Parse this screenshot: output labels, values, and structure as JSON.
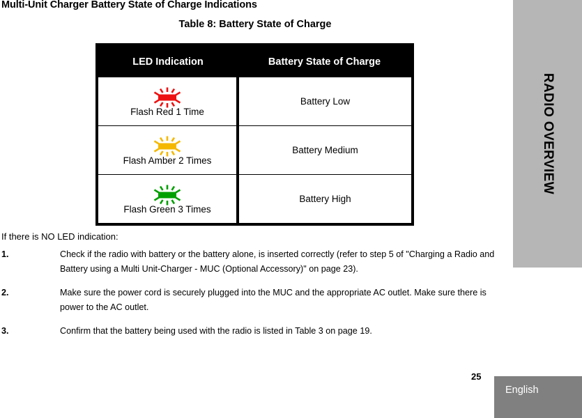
{
  "chapter_tab": {
    "label": "RADIO OVERVIEW",
    "background_color": "#b6b6b6"
  },
  "section_heading": "Multi-Unit Charger Battery State of Charge Indications",
  "table": {
    "caption": "Table 8: Battery State of Charge",
    "header_background": "#000000",
    "header_text_color": "#ffffff",
    "columns": [
      "LED Indication",
      "Battery State of Charge"
    ],
    "rows": [
      {
        "icon_name": "flash-red-led-icon",
        "icon_color": "#ee1111",
        "led_label": "Flash Red 1 Time",
        "state_of_charge": "Battery Low"
      },
      {
        "icon_name": "flash-amber-led-icon",
        "icon_color": "#f5b800",
        "led_label": "Flash Amber 2 Times",
        "state_of_charge": "Battery Medium"
      },
      {
        "icon_name": "flash-green-led-icon",
        "icon_color": "#00a000",
        "led_label": "Flash Green 3 Times",
        "state_of_charge": "Battery High"
      }
    ]
  },
  "body": {
    "lead_line": "If there is NO LED indication:",
    "steps": [
      {
        "number": "1.",
        "text": "Check if the radio with battery or the battery alone, is inserted correctly (refer to step 5 of \"Charging a Radio and Battery using a Multi Unit-Charger - MUC (Optional Accessory)\" on page 23)."
      },
      {
        "number": "2.",
        "text": "Make sure the power cord is securely plugged into the MUC and the appropriate AC outlet. Make sure there is power to the AC outlet."
      },
      {
        "number": "3.",
        "text": "Confirm that the battery being used with the radio is listed in Table 3 on page 19."
      }
    ]
  },
  "footer": {
    "page_number": "25",
    "language": "English",
    "language_box_color": "#808080"
  }
}
